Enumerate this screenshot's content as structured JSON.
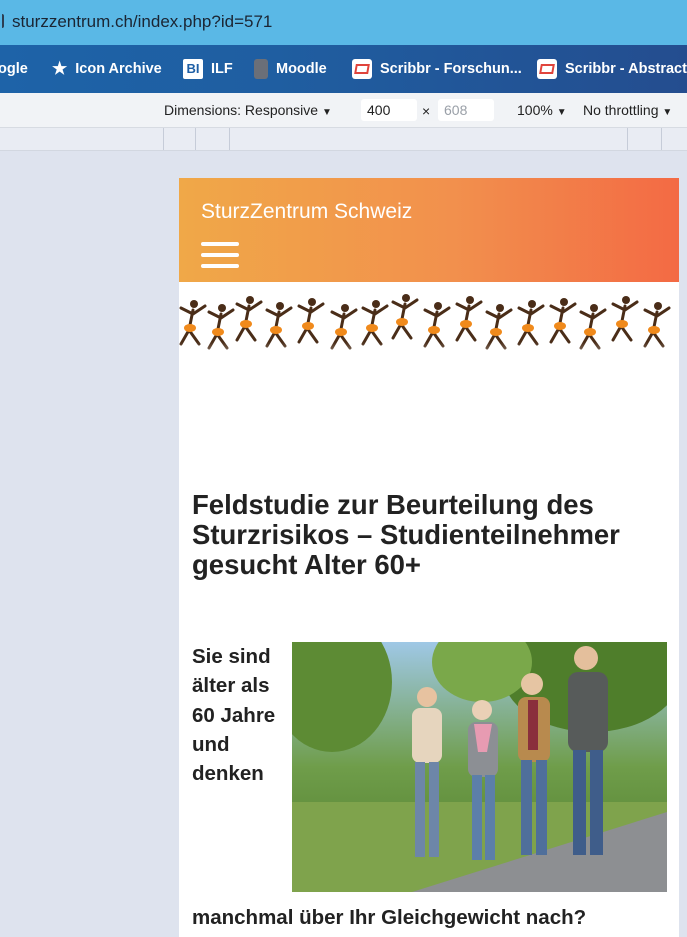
{
  "browser": {
    "url": "sturzzentrum.ch/index.php?id=571",
    "bookmarks": [
      {
        "label": "ogle",
        "icon": "none"
      },
      {
        "label": "Icon Archive",
        "icon": "star-icon"
      },
      {
        "label": "ILF",
        "icon": "bi-icon"
      },
      {
        "label": "Moodle",
        "icon": "moodle-icon"
      },
      {
        "label": "Scribbr - Forschun...",
        "icon": "scribbr-icon"
      },
      {
        "label": "Scribbr - Abstract",
        "icon": "scribbr-icon"
      }
    ],
    "bi_glyph": "BI"
  },
  "devtools": {
    "dimensions_label": "Dimensions: Responsive",
    "width_value": "400",
    "times": "×",
    "height_placeholder": "608",
    "zoom": "100%",
    "throttling": "No throttling",
    "caret": "▼"
  },
  "site": {
    "name": "SturzZentrum Schweiz",
    "heading": "Feldstudie zur Beurteilung des Sturzrisikos – Studienteilnehmer gesucht Alter 60+",
    "intro_text": "Sie sind älter als 60 Jahre und denken",
    "continuation_text": "manchmal über Ihr Gleichgewicht nach?"
  },
  "colors": {
    "header_start": "#f0a848",
    "header_end": "#f36a44",
    "figure_dark": "#4a2d18",
    "figure_accent": "#f08a1c"
  }
}
